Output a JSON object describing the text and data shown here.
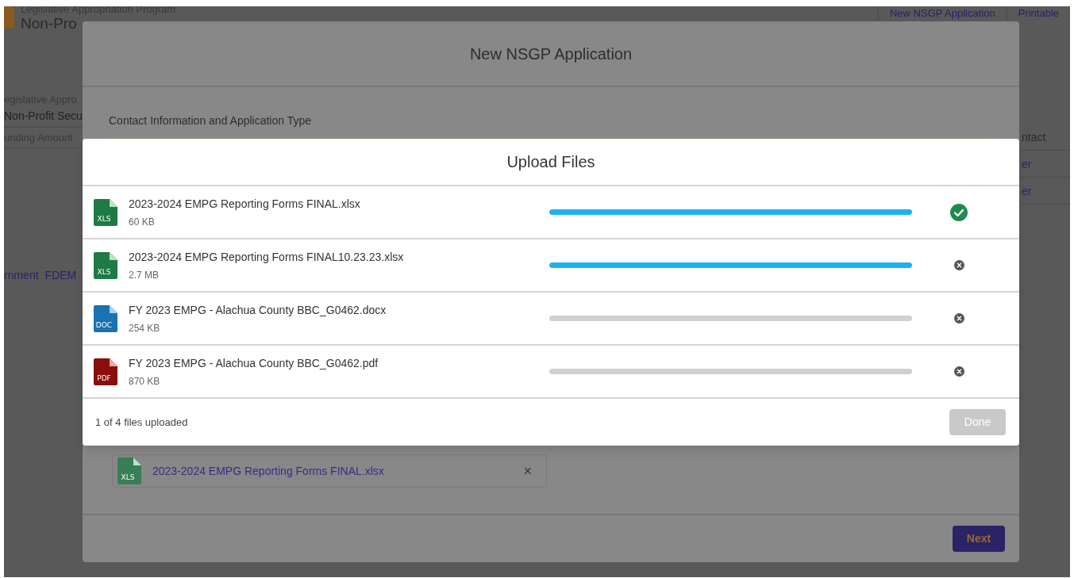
{
  "background_page": {
    "header_subtitle": "Legislative Appropriation Program",
    "header_title": "Non-Pro",
    "header_buttons": [
      "New NSGP Application",
      "Printable"
    ],
    "details": [
      {
        "label": "egislative Appro",
        "value": "Non-Profit Secu"
      },
      {
        "label": "unding Amount"
      }
    ],
    "link_texts": [
      "rnment",
      "FDEM"
    ],
    "table_header": "ntact",
    "table_links": [
      "er",
      "er"
    ]
  },
  "application_modal": {
    "title": "New NSGP Application",
    "section_title": "Contact Information and Application Type",
    "attachment": {
      "type_label": "XLS",
      "name": "2023-2024 EMPG Reporting Forms FINAL.xlsx",
      "remove_icon": "×"
    },
    "next_button": "Next"
  },
  "upload_modal": {
    "title": "Upload Files",
    "files": [
      {
        "kind": "xls",
        "type_label": "XLS",
        "name": "2023-2024 EMPG Reporting Forms FINAL.xlsx",
        "size": "60 KB",
        "level": 1,
        "uploaded": true
      },
      {
        "kind": "xls",
        "type_label": "XLS",
        "name": "2023-2024 EMPG Reporting Forms FINAL10.23.23.xlsx",
        "size": "2.7 MB",
        "level": 1,
        "uploaded": false
      },
      {
        "kind": "doc",
        "type_label": "DOC",
        "name": "FY 2023 EMPG - Alachua County BBC_G0462.docx",
        "size": "254 KB",
        "level": 0,
        "uploaded": false
      },
      {
        "kind": "pdf",
        "type_label": "PDF",
        "name": "FY 2023 EMPG - Alachua County BBC_G0462.pdf",
        "size": "870 KB",
        "level": 0,
        "uploaded": false
      }
    ],
    "status": "1 of 4 files uploaded",
    "done_button": {
      "label": "Done",
      "disabled": true
    }
  }
}
